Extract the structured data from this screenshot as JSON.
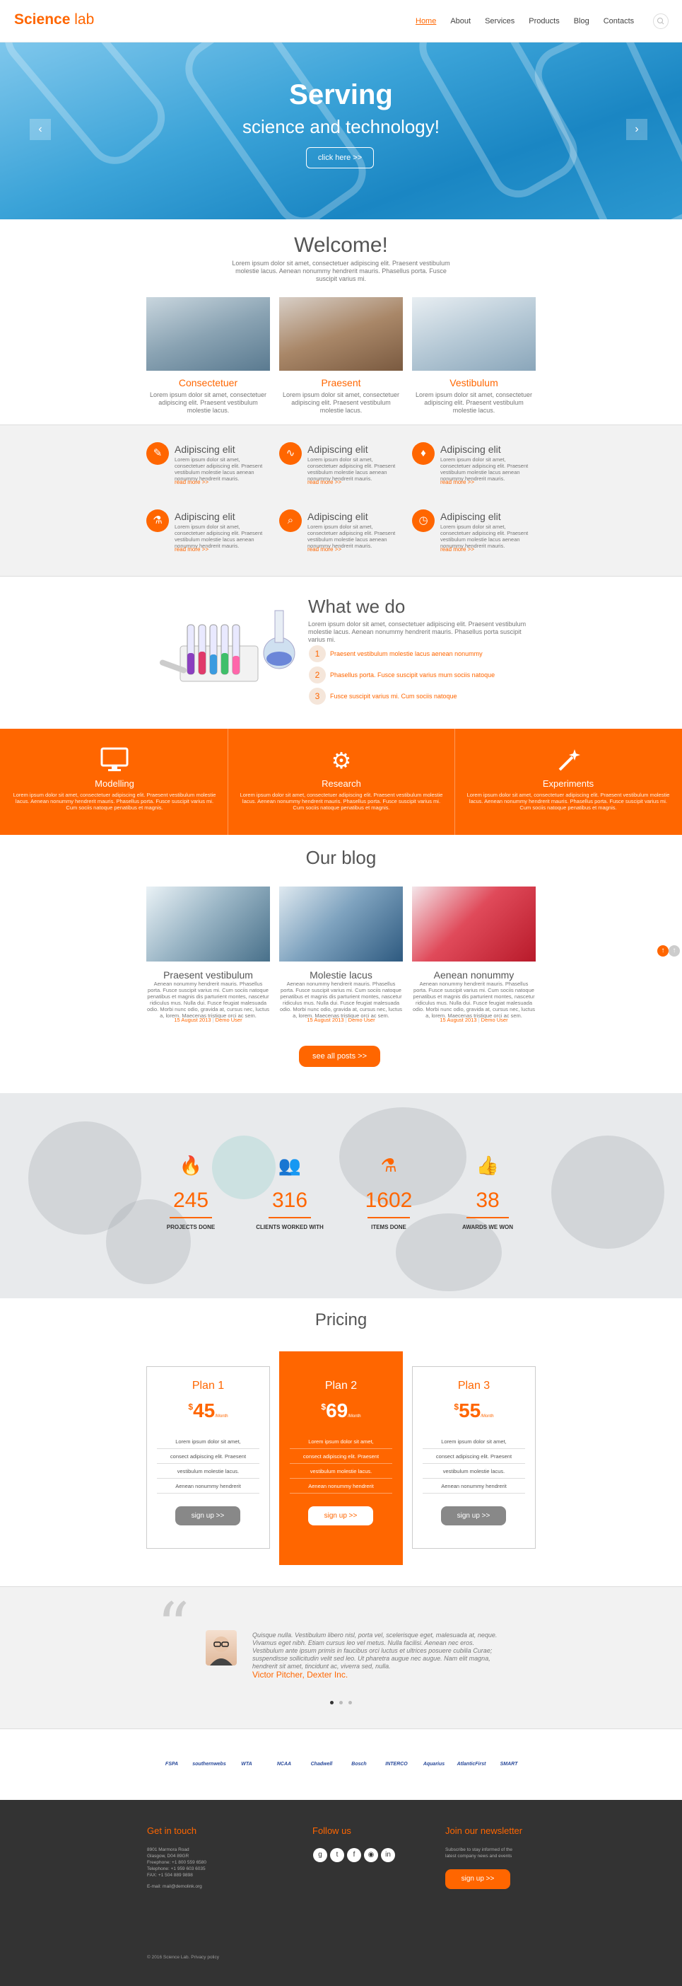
{
  "header": {
    "logo_main": "Science",
    "logo_sub": "lab",
    "nav": [
      "Home",
      "About",
      "Services",
      "Products",
      "Blog",
      "Contacts"
    ],
    "search_icon": "search-icon"
  },
  "hero": {
    "title": "Serving",
    "subtitle": "science and technology!",
    "button": "click here >>",
    "prev": "‹",
    "next": "›"
  },
  "welcome": {
    "title": "Welcome!",
    "text": "Lorem ipsum dolor sit amet, consectetuer adipiscing elit. Praesent vestibulum molestie lacus. Aenean nonummy hendrerit mauris. Phasellus porta. Fusce suscipit varius mi.",
    "items": [
      {
        "title": "Consectetuer",
        "text": "Lorem ipsum dolor sit amet, consectetuer adipiscing elit. Praesent vestibulum molestie lacus."
      },
      {
        "title": "Praesent",
        "text": "Lorem ipsum dolor sit amet, consectetuer adipiscing elit. Praesent vestibulum molestie lacus."
      },
      {
        "title": "Vestibulum",
        "text": "Lorem ipsum dolor sit amet, consectetuer adipiscing elit. Praesent vestibulum molestie lacus."
      }
    ]
  },
  "features": {
    "items": [
      {
        "icon": "pencil-icon",
        "glyph": "✎",
        "title": "Adipiscing elit",
        "text": "Lorem ipsum dolor sit amet, consectetuer adipiscing elit. Praesent vestibulum molestie lacus aenean nonummy hendrerit mauris.",
        "more": "read more >>"
      },
      {
        "icon": "chart-icon",
        "glyph": "∿",
        "title": "Adipiscing elit",
        "text": "Lorem ipsum dolor sit amet, consectetuer adipiscing elit. Praesent vestibulum molestie lacus aenean nonummy hendrerit mauris.",
        "more": "read more >>"
      },
      {
        "icon": "drop-icon",
        "glyph": "♦",
        "title": "Adipiscing elit",
        "text": "Lorem ipsum dolor sit amet, consectetuer adipiscing elit. Praesent vestibulum molestie lacus aenean nonummy hendrerit mauris.",
        "more": "read more >>"
      },
      {
        "icon": "flask-icon",
        "glyph": "⚗",
        "title": "Adipiscing elit",
        "text": "Lorem ipsum dolor sit amet, consectetuer adipiscing elit. Praesent vestibulum molestie lacus aenean nonummy hendrerit mauris.",
        "more": "read more >>"
      },
      {
        "icon": "search-icon",
        "glyph": "⌕",
        "title": "Adipiscing elit",
        "text": "Lorem ipsum dolor sit amet, consectetuer adipiscing elit. Praesent vestibulum molestie lacus aenean nonummy hendrerit mauris.",
        "more": "read more >>"
      },
      {
        "icon": "clock-icon",
        "glyph": "◷",
        "title": "Adipiscing elit",
        "text": "Lorem ipsum dolor sit amet, consectetuer adipiscing elit. Praesent vestibulum molestie lacus aenean nonummy hendrerit mauris.",
        "more": "read more >>"
      }
    ]
  },
  "what_we_do": {
    "title": "What we do",
    "text": "Lorem ipsum dolor sit amet, consectetuer adipiscing elit. Praesent vestibulum molestie lacus. Aenean nonummy hendrerit mauris. Phasellus porta suscipit varius mi.",
    "items": [
      {
        "num": "1",
        "text": "Praesent vestibulum molestie lacus aenean nonummy"
      },
      {
        "num": "2",
        "text": "Phasellus porta. Fusce suscipit varius mum sociis natoque"
      },
      {
        "num": "3",
        "text": "Fusce suscipit varius mi. Cum sociis natoque"
      }
    ]
  },
  "band": {
    "items": [
      {
        "icon": "monitor-icon",
        "glyph": "🖥",
        "title": "Modelling",
        "text": "Lorem ipsum dolor sit amet, consectetuer adipiscing elit. Praesent vestibulum molestie lacus. Aenean nonummy hendrerit mauris. Phasellus porta. Fusce suscipit varius mi. Cum sociis natoque penatibus et magnis."
      },
      {
        "icon": "gears-icon",
        "glyph": "⚙",
        "title": "Research",
        "text": "Lorem ipsum dolor sit amet, consectetuer adipiscing elit. Praesent vestibulum molestie lacus. Aenean nonummy hendrerit mauris. Phasellus porta. Fusce suscipit varius mi. Cum sociis natoque penatibus et magnis."
      },
      {
        "icon": "wand-icon",
        "glyph": "✦",
        "title": "Experiments",
        "text": "Lorem ipsum dolor sit amet, consectetuer adipiscing elit. Praesent vestibulum molestie lacus. Aenean nonummy hendrerit mauris. Phasellus porta. Fusce suscipit varius mi. Cum sociis natoque penatibus et magnis."
      }
    ]
  },
  "blog": {
    "title": "Our blog",
    "posts": [
      {
        "title": "Praesent vestibulum",
        "text": "Aenean nonummy hendrerit mauris. Phasellus porta. Fusce suscipit varius mi. Cum sociis natoque penatibus et magnis dis parturient montes, nascetur ridiculus mus. Nulla dui. Fusce feugiat malesuada odio. Morbi nunc odio, gravida at, cursus nec, luctus a, lorem. Maecenas tristique orci ac sem.",
        "date": "15 August 2013",
        "author": "Demo User"
      },
      {
        "title": "Molestie lacus",
        "text": "Aenean nonummy hendrerit mauris. Phasellus porta. Fusce suscipit varius mi. Cum sociis natoque penatibus et magnis dis parturient montes, nascetur ridiculus mus. Nulla dui. Fusce feugiat malesuada odio. Morbi nunc odio, gravida at, cursus nec, luctus a, lorem. Maecenas tristique orci ac sem.",
        "date": "15 August 2013",
        "author": "Demo User"
      },
      {
        "title": "Aenean nonummy",
        "text": "Aenean nonummy hendrerit mauris. Phasellus porta. Fusce suscipit varius mi. Cum sociis natoque penatibus et magnis dis parturient montes, nascetur ridiculus mus. Nulla dui. Fusce feugiat malesuada odio. Morbi nunc odio, gravida at, cursus nec, luctus a, lorem. Maecenas tristique orci ac sem.",
        "date": "15 August 2013",
        "author": "Demo User"
      }
    ],
    "button": "see all posts >>"
  },
  "stats": {
    "items": [
      {
        "icon": "fire-icon",
        "glyph": "🔥",
        "value": "245",
        "label": "PROJECTS DONE"
      },
      {
        "icon": "users-icon",
        "glyph": "👥",
        "value": "316",
        "label": "CLIENTS WORKED WITH"
      },
      {
        "icon": "flask-icon",
        "glyph": "⚗",
        "value": "1602",
        "label": "ITEMS DONE"
      },
      {
        "icon": "thumbs-up-icon",
        "glyph": "👍",
        "value": "38",
        "label": "AWARDS WE WON"
      }
    ]
  },
  "pricing": {
    "title": "Pricing",
    "plans": [
      {
        "name": "Plan 1",
        "currency": "$",
        "price": "45",
        "period": "/Month",
        "features": [
          "Lorem ipsum dolor sit amet,",
          "consect adipiscing elit. Praesent",
          "vestibulum molestie lacus.",
          "Aenean nonummy hendrerit"
        ],
        "button": "sign up >>"
      },
      {
        "name": "Plan 2",
        "currency": "$",
        "price": "69",
        "period": "/Month",
        "features": [
          "Lorem ipsum dolor sit amet,",
          "consect adipiscing elit. Praesent",
          "vestibulum molestie lacus.",
          "Aenean nonummy hendrerit"
        ],
        "button": "sign up >>"
      },
      {
        "name": "Plan 3",
        "currency": "$",
        "price": "55",
        "period": "/Month",
        "features": [
          "Lorem ipsum dolor sit amet,",
          "consect adipiscing elit. Praesent",
          "vestibulum molestie lacus.",
          "Aenean nonummy hendrerit"
        ],
        "button": "sign up >>"
      }
    ]
  },
  "testimonial": {
    "quote_mark": "“",
    "text": "Quisque nulla. Vestibulum libero nisl, porta vel, scelerisque eget, malesuada at, neque. Vivamus eget nibh. Etiam cursus leo vel metus. Nulla facilisi. Aenean nec eros. Vestibulum ante ipsum primis in faucibus orci luctus et ultrices posuere cubilia Curae; suspendisse sollicitudin velit sed leo. Ut pharetra augue nec augue. Nam elit magna, hendrerit sit amet, tincidunt ac, viverra sed, nulla.",
    "name": "Victor Pitcher, Dexter Inc."
  },
  "partners": [
    "FSPA",
    "southernwebs",
    "WTA",
    "NCAA",
    "Chadwell",
    "Bosch",
    "INTERCO",
    "Aquarius",
    "AtlanticFirst",
    "SMART"
  ],
  "footer": {
    "contact_title": "Get in touch",
    "address": [
      "8901 Marmora Road",
      "Glasgow, D04 89GR",
      "Freephone:    +1 800 559 6580",
      "Telephone:    +1 959 603 6035",
      "FAX:            +1 504 889 9898"
    ],
    "email": "E-mail: mail@demolink.org",
    "follow_title": "Follow us",
    "social": [
      {
        "icon": "google-plus-icon",
        "glyph": "g"
      },
      {
        "icon": "twitter-icon",
        "glyph": "t"
      },
      {
        "icon": "facebook-icon",
        "glyph": "f"
      },
      {
        "icon": "rss-icon",
        "glyph": "◉"
      },
      {
        "icon": "linkedin-icon",
        "glyph": "in"
      }
    ],
    "newsletter_title": "Join our newsletter",
    "newsletter_text": "Subscribe to stay informed of the latest company news and events",
    "newsletter_button": "sign up >>",
    "copyright": "© 2016 Science Lab. Privacy policy"
  },
  "colors": {
    "accent": "#ff6600",
    "dark": "#333333",
    "light": "#f2f2f2"
  }
}
